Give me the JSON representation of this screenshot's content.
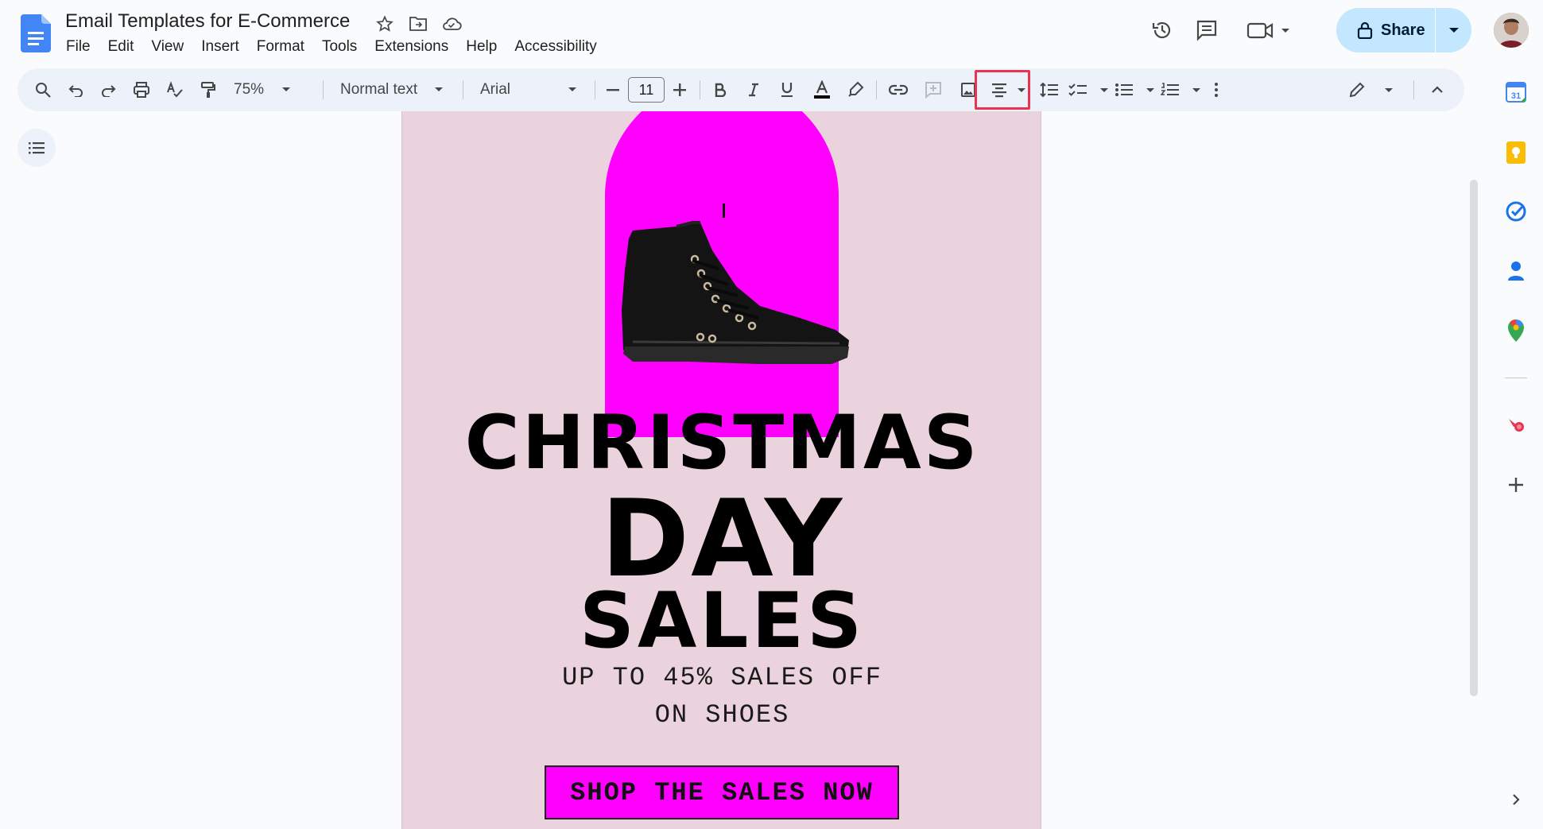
{
  "document": {
    "title": "Email Templates for E-Commerce"
  },
  "menu": {
    "items": [
      "File",
      "Edit",
      "View",
      "Insert",
      "Format",
      "Tools",
      "Extensions",
      "Help",
      "Accessibility"
    ]
  },
  "header": {
    "share_label": "Share"
  },
  "toolbar": {
    "zoom": "75%",
    "style": "Normal text",
    "font": "Arial",
    "font_size": "11",
    "highlighted_tool": "align-center"
  },
  "content": {
    "headline_line1": "CHRISTMAS",
    "headline_line2": "DAY",
    "headline_line3": "SALES",
    "subtext_line1": "UP TO 45% SALES OFF",
    "subtext_line2": "ON SHOES",
    "cta_label": "SHOP THE SALES NOW"
  },
  "colors": {
    "page_background": "#ebd3de",
    "accent_magenta": "#ff00ff",
    "share_button": "#c2e7ff",
    "highlight_border": "#e8344e"
  }
}
